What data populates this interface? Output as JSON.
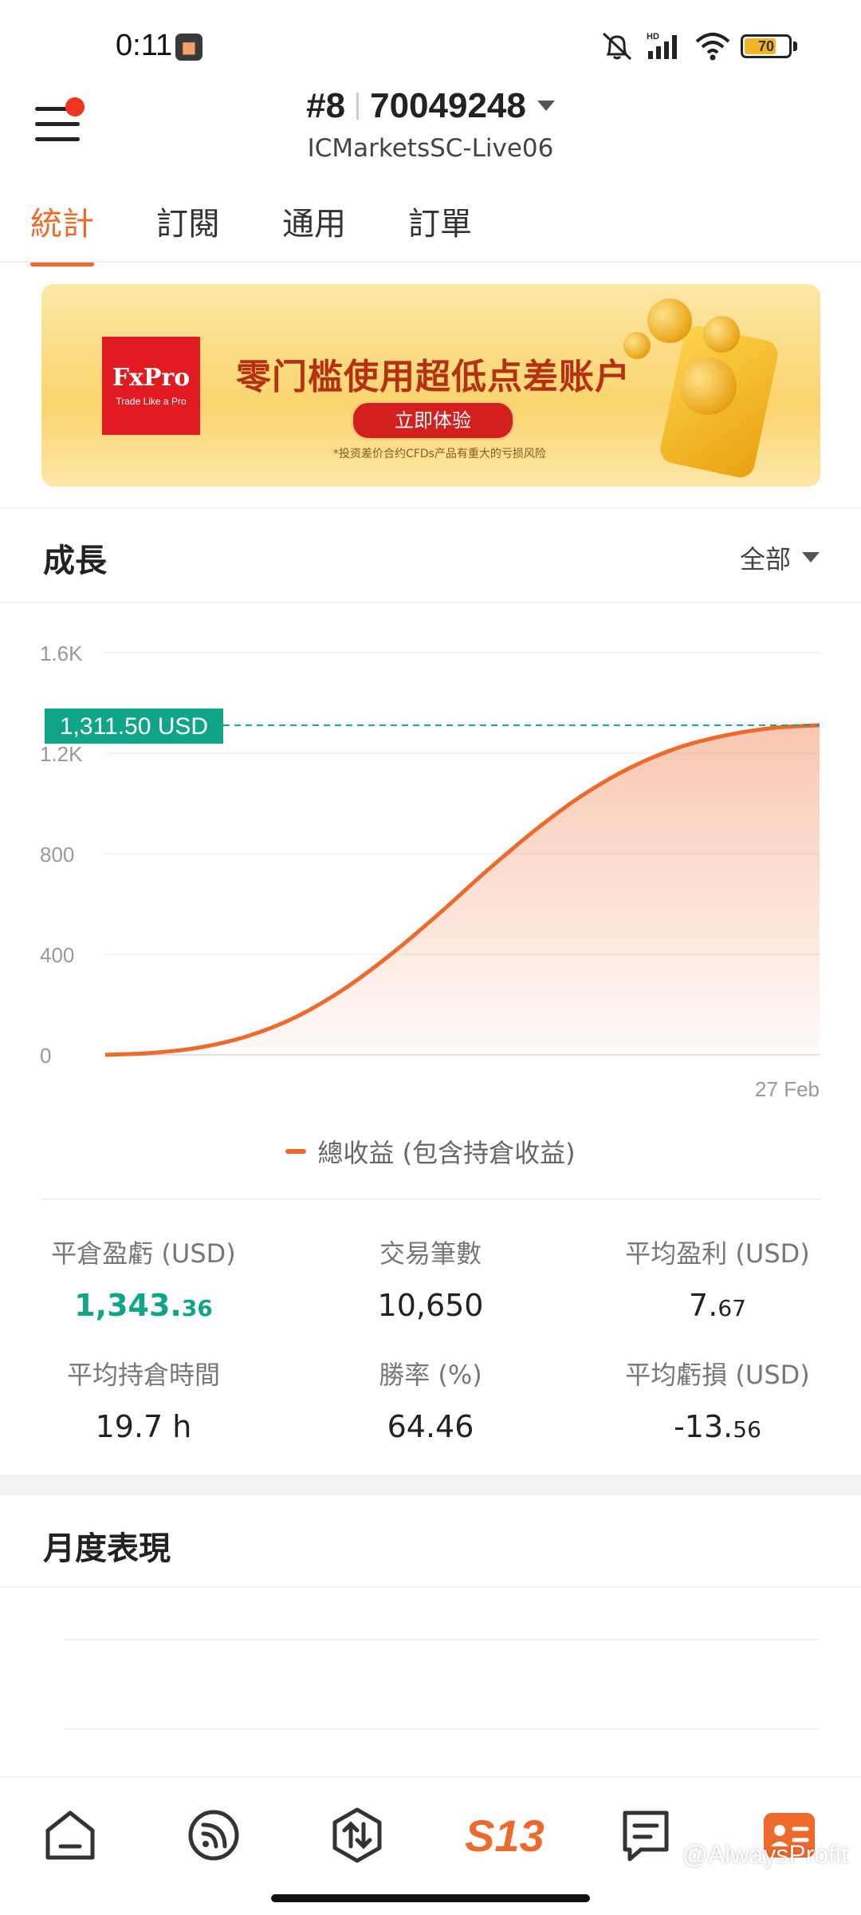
{
  "status_bar": {
    "time": "0:11",
    "battery_level": "70",
    "battery_color": "#f0b428",
    "icons": [
      "mute-icon",
      "hd-signal-icon",
      "wifi-icon",
      "battery-icon"
    ]
  },
  "header": {
    "account_rank": "#8",
    "account_number": "70049248",
    "server": "ICMarketsSC-Live06",
    "notification_dot_color": "#f0341f"
  },
  "tabs": [
    {
      "label": "統計",
      "active": true
    },
    {
      "label": "訂閱",
      "active": false
    },
    {
      "label": "通用",
      "active": false
    },
    {
      "label": "訂單",
      "active": false
    }
  ],
  "banner": {
    "brand": "FxPro",
    "brand_tagline": "Trade Like a Pro",
    "headline": "零门槛使用超低点差账户",
    "cta": "立即体验",
    "disclaimer": "*投资差价合约CFDs产品有重大的亏损风险"
  },
  "growth": {
    "title": "成長",
    "filter": "全部",
    "current_value_label": "1,311.50 USD",
    "legend": "總收益 (包含持倉收益)",
    "accent_color": "#ee6a2c",
    "tag_color": "#10a589"
  },
  "chart_data": {
    "type": "area",
    "ylim": [
      0,
      1600
    ],
    "yticks": [
      0,
      400,
      800,
      1200,
      1600
    ],
    "ytick_labels": [
      "0",
      "400",
      "800",
      "1.2K",
      "1.6K"
    ],
    "x_label_right": "27 Feb",
    "reference_value": 1311.5,
    "series": [
      {
        "values": [
          0,
          8,
          30,
          75,
          150,
          260,
          400,
          560,
          730,
          890,
          1030,
          1140,
          1220,
          1270,
          1300,
          1311.5
        ]
      }
    ]
  },
  "stats": [
    {
      "label": "平倉盈虧 (USD)",
      "int": "1,343.",
      "dec": "36",
      "green": true
    },
    {
      "label": "交易筆數",
      "int": "10,650",
      "dec": "",
      "green": false
    },
    {
      "label": "平均盈利 (USD)",
      "int": "7.",
      "dec": "67",
      "green": false
    },
    {
      "label": "平均持倉時間",
      "int": "19.7 h",
      "dec": "",
      "green": false
    },
    {
      "label": "勝率 (%)",
      "int": "64.46",
      "dec": "",
      "green": false
    },
    {
      "label": "平均虧損 (USD)",
      "int": "-13.",
      "dec": "56",
      "green": false
    }
  ],
  "monthly": {
    "title": "月度表現"
  },
  "bottom_nav": {
    "items": [
      {
        "name": "home-icon",
        "active": false
      },
      {
        "name": "signal-feed-icon",
        "active": false
      },
      {
        "name": "trade-icon",
        "active": false
      },
      {
        "name": "s13-logo-icon",
        "text": "S13",
        "active": false
      },
      {
        "name": "messages-icon",
        "active": false
      },
      {
        "name": "profile-icon",
        "active": true
      }
    ]
  },
  "watermark": "@AlwaysProfit"
}
